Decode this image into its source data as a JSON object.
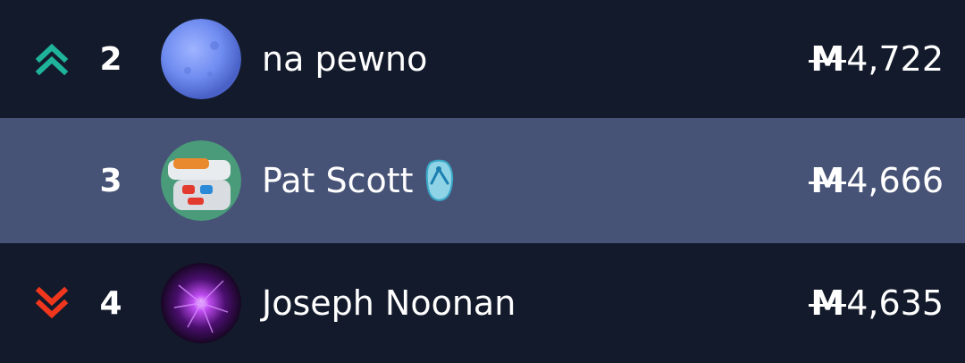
{
  "currency_symbol": "M",
  "colors": {
    "background": "#131a2b",
    "highlight_row": "#475376",
    "trend_up": "#1fb39b",
    "trend_down": "#f0371e",
    "text": "#ffffff"
  },
  "rows": [
    {
      "rank": "2",
      "name": "na pewno",
      "amount": "4,722",
      "trend": "up",
      "trend_icon": "double-chevron-up-icon",
      "avatar": "blue-moon-avatar",
      "highlighted": false
    },
    {
      "rank": "3",
      "name": "Pat Scott",
      "emoji": "flip-flop-icon",
      "amount": "4,666",
      "trend": "none",
      "avatar": "crocs-shoe-avatar",
      "highlighted": true
    },
    {
      "rank": "4",
      "name": "Joseph Noonan",
      "amount": "4,635",
      "trend": "down",
      "trend_icon": "double-chevron-down-icon",
      "avatar": "purple-plasma-avatar",
      "highlighted": false
    }
  ]
}
